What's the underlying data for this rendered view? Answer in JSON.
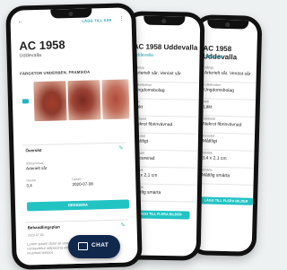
{
  "front": {
    "top_bar": {
      "back": "←",
      "save": "LÄGG TILL SÅR",
      "more": "⋮"
    },
    "title": "AC 1958",
    "subtitle": "Uddevalla",
    "patient_banner": "FÄRGSTOR UNDERBEN, FRAMSIDA",
    "overview": {
      "title": "Översikt",
      "f1_label": "Sårtyp/orsak",
      "f1_value": "Arterielt sår",
      "f2_label": "Storlek",
      "f2_value": "3,4",
      "f3_label": "Datum",
      "f3_value": "2020-07-08",
      "button": "REDIGERA"
    },
    "treatment": {
      "title": "Behandlingsplan",
      "date": "2020-07-08",
      "text": "Lorem ipsum dolor sit amet, consectetur adipiscing elit sed do eiusmod tempor"
    },
    "chat_label": "CHAT"
  },
  "middle": {
    "title": "AC 1958 Uddevalla",
    "subtitle": "Uddevalla",
    "rows": [
      {
        "label": "Sårtyp",
        "value": "Arterielt sår, Venöst sår"
      },
      {
        "label": "Lokalisation",
        "value": "Ungdomsbolag"
      },
      {
        "label": "Mål",
        "value": "Läkt"
      },
      {
        "label": "Sårbädd",
        "value": "Nekrot fibrinvävnad"
      },
      {
        "label": "Exsudat",
        "value": "Måttligt"
      },
      {
        "label": "Sårkant",
        "value": "Macererad"
      },
      {
        "label": "Storlek",
        "value": "3,4 x 2,1 cm"
      },
      {
        "label": "Smärta",
        "value": "Måttlig smärta"
      }
    ],
    "button": "LÄGG TILL FLERA BILDER"
  },
  "back": {
    "title": "AC 1958 Uddevalla",
    "subtitle": "Uddevalla",
    "rows": [
      {
        "label": "Sårtyp",
        "value": "Arterielt sår, Venöst sår"
      },
      {
        "label": "Lokalisation",
        "value": "Ungdomsbolag"
      },
      {
        "label": "Mål",
        "value": "Läkt"
      },
      {
        "label": "Sårbädd",
        "value": "Nekrot fibrinvävnad"
      },
      {
        "label": "Exsudat",
        "value": "Måttligt"
      },
      {
        "label": "Storlek",
        "value": "3,4 x 2,1 cm"
      },
      {
        "label": "Smärta",
        "value": "Måttlig smärta"
      }
    ],
    "button": "LÄGG TILL FLERA BILDER"
  },
  "colors": {
    "accent": "#22c3c3",
    "chat": "#11284d",
    "link": "#1a9fb0"
  }
}
